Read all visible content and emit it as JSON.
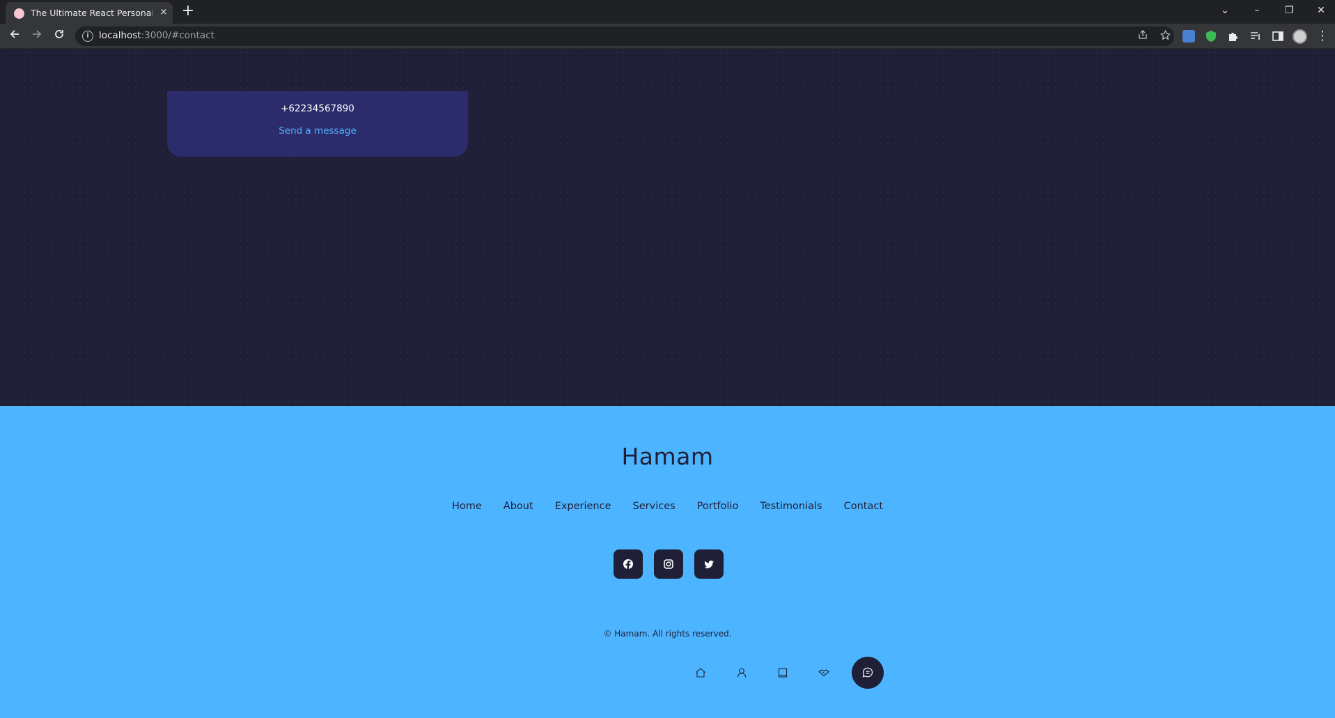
{
  "browser": {
    "tab_title": "The Ultimate React Personal Portfolio",
    "tab_close": "×",
    "new_tab": "+",
    "url_host": "localhost",
    "url_path": ":3000/#contact",
    "window_controls": [
      "⌄",
      "–",
      "❐",
      "✕"
    ]
  },
  "contact_card": {
    "phone": "+62234567890",
    "link_label": "Send a message"
  },
  "footer": {
    "logo": "Hamam",
    "links": [
      "Home",
      "About",
      "Experience",
      "Services",
      "Portfolio",
      "Testimonials",
      "Contact"
    ],
    "socials": [
      "facebook-icon",
      "instagram-icon",
      "twitter-icon"
    ],
    "copyright": "© Hamam. All rights reserved."
  },
  "bottom_nav": {
    "items": [
      "home-icon",
      "user-icon",
      "book-icon",
      "handshake-icon",
      "message-icon"
    ],
    "active": "message-icon"
  },
  "colors": {
    "bg": "#1f1f38",
    "primary": "#4db5ff",
    "card": "#2c2c6c"
  }
}
